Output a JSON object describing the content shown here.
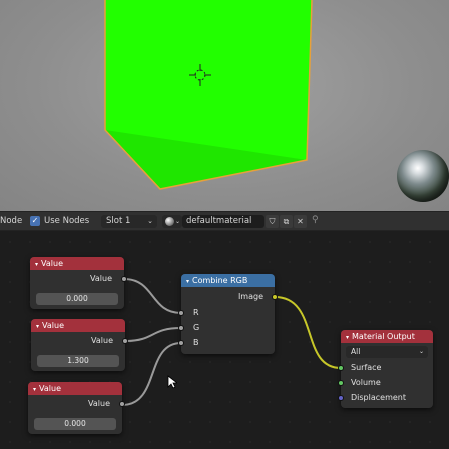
{
  "header": {
    "node_label": "Node",
    "use_nodes_label": "Use Nodes",
    "slot": "Slot 1",
    "material_name": "defaultmaterial",
    "checkmark": "✓",
    "chevron": "⌄",
    "shield_glyph": "⛉",
    "copy_glyph": "⧉",
    "close_glyph": "✕",
    "pin_glyph": "⚲"
  },
  "nodes": {
    "value1": {
      "title": "Value",
      "output": "Value",
      "value": "0.000"
    },
    "value2": {
      "title": "Value",
      "output": "Value",
      "value": "1.300"
    },
    "value3": {
      "title": "Value",
      "output": "Value",
      "value": "0.000"
    },
    "combine": {
      "title": "Combine RGB",
      "output": "Image",
      "inputs": [
        "R",
        "G",
        "B"
      ]
    },
    "output": {
      "title": "Material Output",
      "target": "All",
      "inputs": [
        "Surface",
        "Volume",
        "Displacement"
      ]
    }
  },
  "colors": {
    "cube": "#22ff00",
    "value_header": "#a3313c",
    "converter_header": "#3b6fa3",
    "output_header": "#a3313c",
    "socket_float": "#a1a1a1",
    "socket_color": "#c7c729",
    "socket_shader": "#63c763",
    "socket_vector": "#6363c7"
  },
  "icons": {
    "triangle": "▾"
  }
}
